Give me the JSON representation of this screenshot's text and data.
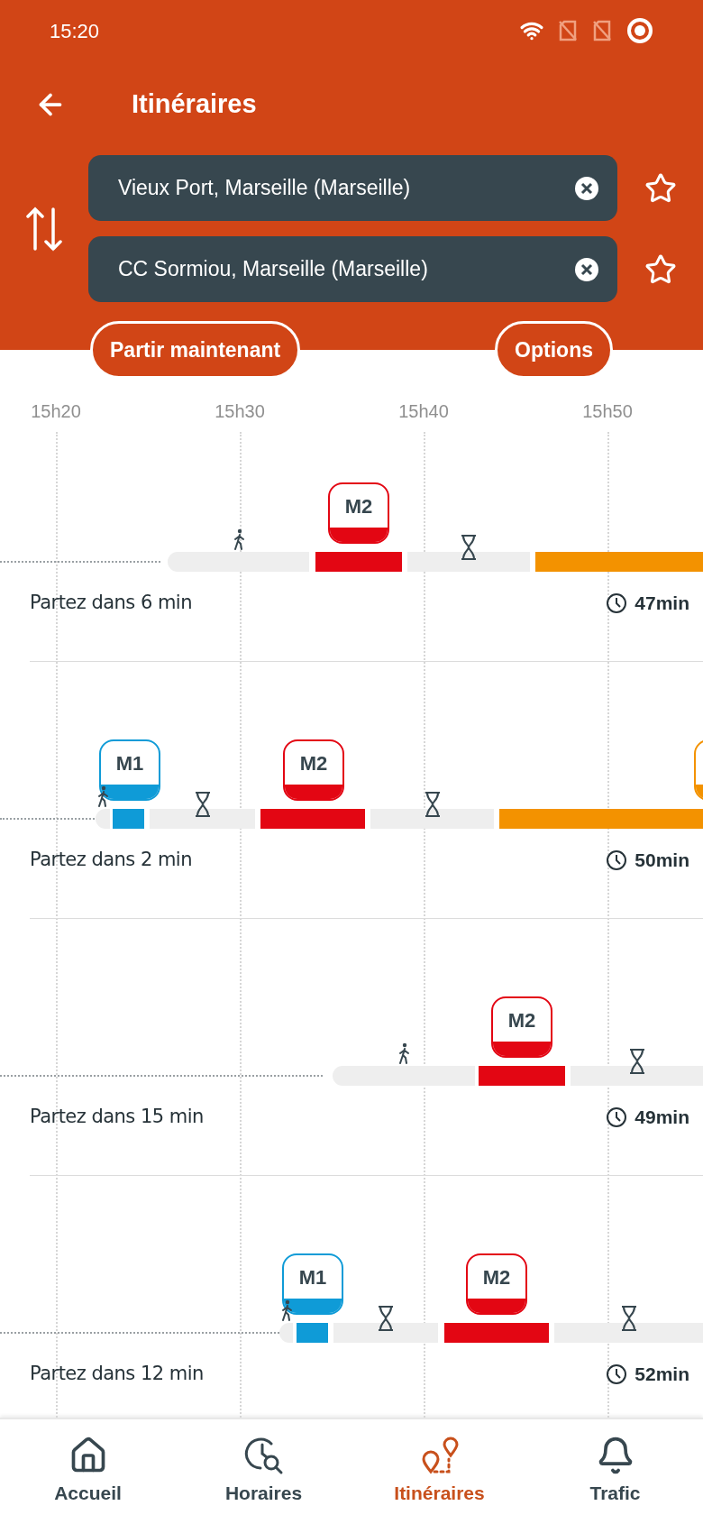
{
  "status_bar": {
    "time": "15:20"
  },
  "header": {
    "title": "Itinéraires"
  },
  "fields": [
    {
      "value": "Vieux Port, Marseille (Marseille)",
      "favorite": false
    },
    {
      "value": "CC Sormiou, Marseille (Marseille)",
      "favorite": false
    }
  ],
  "actions": [
    "Partir maintenant",
    "Options"
  ],
  "timeline": {
    "ticks": [
      "15h20",
      "15h30",
      "15h40",
      "15h50"
    ]
  },
  "journeys": [
    {
      "departure": "Partez dans 6 min",
      "duration": "47min",
      "segments": [
        {
          "kind": "walk"
        },
        {
          "kind": "line",
          "label": "M2",
          "color": "#e30613",
          "badge": true
        },
        {
          "kind": "wait"
        },
        {
          "kind": "line",
          "color": "#f39200",
          "badge": false
        }
      ]
    },
    {
      "departure": "Partez dans 2 min",
      "duration": "50min",
      "segments": [
        {
          "kind": "walk"
        },
        {
          "kind": "line",
          "label": "M1",
          "color": "#0f9bd7",
          "badge": true
        },
        {
          "kind": "wait"
        },
        {
          "kind": "line",
          "label": "M2",
          "color": "#e30613",
          "badge": true
        },
        {
          "kind": "wait"
        },
        {
          "kind": "line",
          "color": "#f39200",
          "badge": true
        }
      ]
    },
    {
      "departure": "Partez dans 15 min",
      "duration": "49min",
      "segments": [
        {
          "kind": "walk"
        },
        {
          "kind": "line",
          "label": "M2",
          "color": "#e30613",
          "badge": true
        },
        {
          "kind": "wait"
        }
      ]
    },
    {
      "departure": "Partez dans 12 min",
      "duration": "52min",
      "segments": [
        {
          "kind": "walk"
        },
        {
          "kind": "line",
          "label": "M1",
          "color": "#0f9bd7",
          "badge": true
        },
        {
          "kind": "wait"
        },
        {
          "kind": "line",
          "label": "M2",
          "color": "#e30613",
          "badge": true
        },
        {
          "kind": "wait"
        }
      ]
    }
  ],
  "nav": [
    {
      "label": "Accueil",
      "selected": false
    },
    {
      "label": "Horaires",
      "selected": false
    },
    {
      "label": "Itinéraires",
      "selected": true
    },
    {
      "label": "Trafic",
      "selected": false
    }
  ]
}
